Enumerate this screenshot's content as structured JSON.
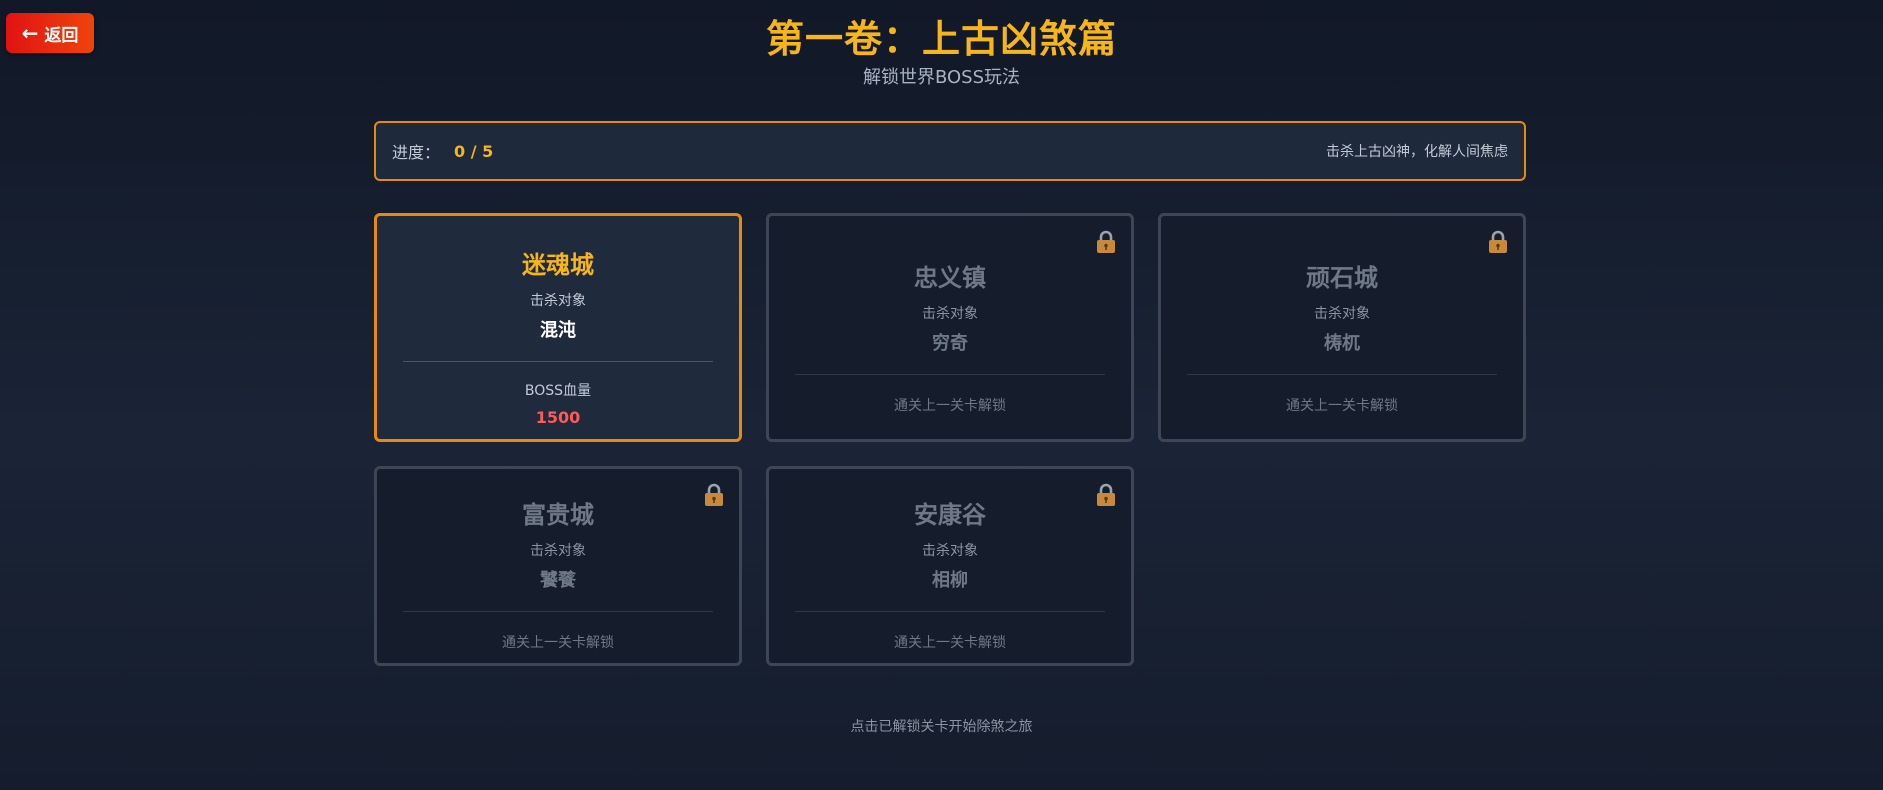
{
  "back_button": {
    "arrow": "←",
    "label": "返回"
  },
  "header": {
    "title": "第一卷：上古凶煞篇",
    "subtitle": "解锁世界BOSS玩法"
  },
  "progress": {
    "label": "进度：",
    "value": "0 / 5",
    "hint": "击杀上古凶神，化解人间焦虑"
  },
  "levels": [
    {
      "name": "迷魂城",
      "kill_label": "击杀对象",
      "boss": "混沌",
      "hp_label": "BOSS血量",
      "hp": "1500",
      "locked": false
    },
    {
      "name": "忠义镇",
      "kill_label": "击杀对象",
      "boss": "穷奇",
      "unlock_hint": "通关上一关卡解锁",
      "locked": true
    },
    {
      "name": "顽石城",
      "kill_label": "击杀对象",
      "boss": "梼杌",
      "unlock_hint": "通关上一关卡解锁",
      "locked": true
    },
    {
      "name": "富贵城",
      "kill_label": "击杀对象",
      "boss": "饕餮",
      "unlock_hint": "通关上一关卡解锁",
      "locked": true
    },
    {
      "name": "安康谷",
      "kill_label": "击杀对象",
      "boss": "相柳",
      "unlock_hint": "通关上一关卡解锁",
      "locked": true
    }
  ],
  "footer": {
    "text": "点击已解锁关卡开始除煞之旅"
  },
  "colors": {
    "accent": "#f5b51b",
    "border_active": "#e88a10",
    "hp": "#ff5a5a",
    "back_button": "#e01212"
  },
  "icons": {
    "lock": "lock-icon",
    "back": "arrow-left-icon"
  }
}
